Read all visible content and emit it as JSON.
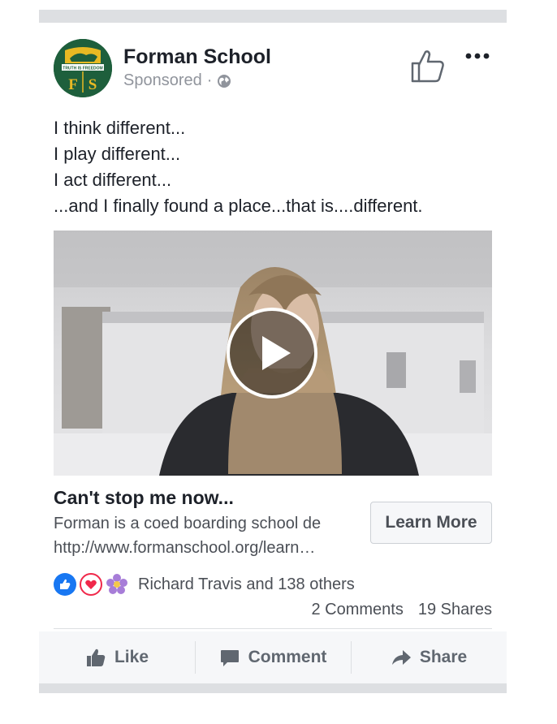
{
  "post": {
    "page_name": "Forman School",
    "sponsored": "Sponsored",
    "sponsored_separator": "·",
    "logo_motto": "TRUTH IS FREEDOM",
    "logo_letters": [
      "F",
      "S"
    ],
    "lines": [
      "I think different...",
      "I play different...",
      "I act different...",
      "...and I finally found a place...that is....different."
    ]
  },
  "link": {
    "title": "Can't stop me now...",
    "description": "Forman is a coed boarding school de",
    "url": "http://www.formanschool.org/learn…",
    "cta": "Learn More"
  },
  "social": {
    "reaction_icons": [
      "like-reaction-icon",
      "love-reaction-icon",
      "flower-reaction-icon"
    ],
    "reactors": "Richard Travis and 138 others",
    "comments": "2 Comments",
    "shares": "19 Shares"
  },
  "actions": {
    "like": "Like",
    "comment": "Comment",
    "share": "Share"
  },
  "colors": {
    "logo_green": "#1e5f3c",
    "logo_gold": "#e8b923",
    "like_blue": "#1877f2",
    "love_red": "#f0284a",
    "flower_purple": "#a77dd8"
  }
}
